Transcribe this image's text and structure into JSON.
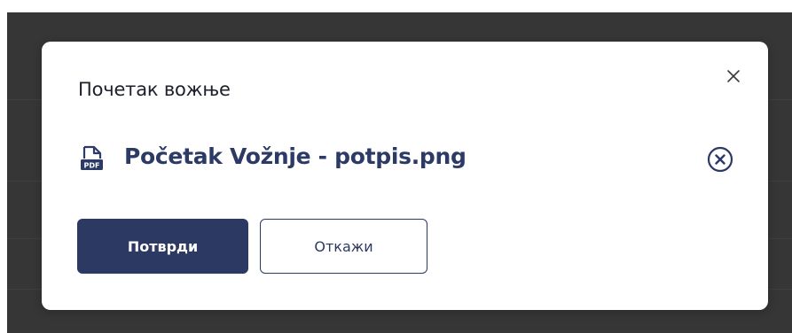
{
  "modal": {
    "title": "Почетак вожње",
    "file": {
      "name": "Početak Vožnje - potpis.png",
      "icon": "pdf-file-icon",
      "icon_badge": "PDF"
    },
    "buttons": {
      "confirm": "Потврди",
      "cancel": "Откажи"
    },
    "close_icon": "close-icon",
    "remove_icon": "remove-file-icon"
  },
  "colors": {
    "primary": "#2c3962",
    "link": "#2c3a66",
    "backdrop": "#363636",
    "title": "#1d1f2b"
  }
}
